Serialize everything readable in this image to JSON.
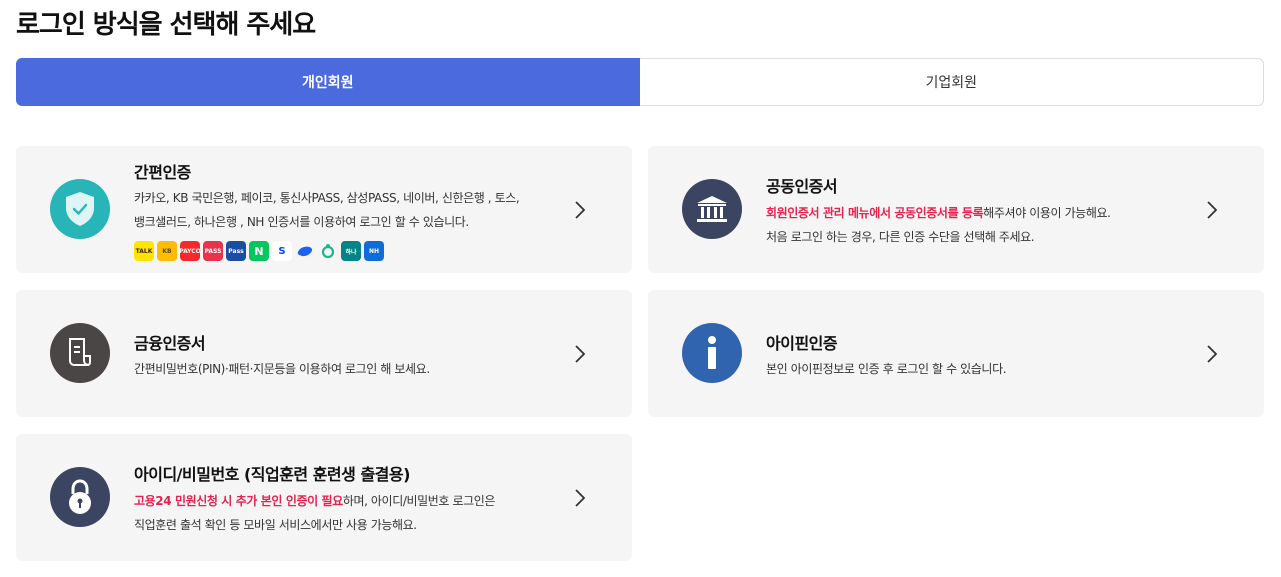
{
  "page_title": "로그인 방식을 선택해 주세요",
  "tabs": [
    {
      "label": "개인회원",
      "active": true
    },
    {
      "label": "기업회원",
      "active": false
    }
  ],
  "colors": {
    "accent": "#4a6ade",
    "highlight": "#e5234c",
    "card_bg": "#f5f5f5"
  },
  "cards": {
    "simple_auth": {
      "title": "간편인증",
      "desc_line1": "카카오, KB 국민은행, 페이코, 통신사PASS, 삼성PASS, 네이버, 신한은행 , 토스,",
      "desc_line2": "뱅크샐러드, 하나은행 , NH 인증서를 이용하여 로그인 할 수 있습니다.",
      "icon": "shield-check-icon",
      "logos": [
        {
          "name": "kakao",
          "text": "TALK"
        },
        {
          "name": "kb",
          "text": "KB"
        },
        {
          "name": "payco",
          "text": "PAYCO"
        },
        {
          "name": "pass",
          "text": "PASS"
        },
        {
          "name": "samsung-pass",
          "text": "Pass"
        },
        {
          "name": "naver",
          "text": "N"
        },
        {
          "name": "shinhan",
          "text": "S"
        },
        {
          "name": "toss",
          "text": ""
        },
        {
          "name": "banksalad",
          "text": ""
        },
        {
          "name": "hana",
          "text": "하나"
        },
        {
          "name": "nh",
          "text": "NH"
        }
      ]
    },
    "joint_cert": {
      "title": "공동인증서",
      "desc_highlight": "회원인증서 관리 메뉴에서 공동인증서를 등록",
      "desc_rest": "해주셔야 이용이 가능해요.",
      "desc_line2": "처음 로그인 하는 경우, 다른 인증 수단을 선택해 주세요.",
      "icon": "bank-building-icon"
    },
    "finance_cert": {
      "title": "금융인증서",
      "desc_line1": "간편비밀번호(PIN)·패턴·지문등을 이용하여 로그인 해 보세요.",
      "icon": "document-icon"
    },
    "ipin": {
      "title": "아이핀인증",
      "desc_line1": "본인 아이핀정보로 인증 후 로그인 할 수 있습니다.",
      "icon": "info-icon"
    },
    "id_password": {
      "title": "아이디/비밀번호 (직업훈련 훈련생 출결용)",
      "desc_highlight": "고용24 민원신청 시 추가 본인 인증이 필요",
      "desc_rest": "하며, 아이디/비밀번호 로그인은",
      "desc_line2": "직업훈련 출석 확인 등 모바일 서비스에서만 사용 가능해요.",
      "icon": "lock-icon"
    }
  }
}
